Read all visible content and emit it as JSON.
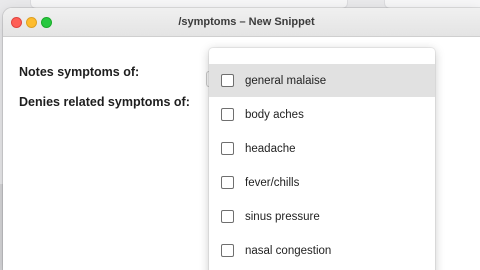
{
  "window": {
    "title": "/symptoms – New Snippet"
  },
  "form": {
    "notes_label": "Notes symptoms of:",
    "denies_label": "Denies related symptoms of:"
  },
  "dropdown": {
    "options": [
      {
        "label": "general malaise",
        "checked": false,
        "highlighted": true
      },
      {
        "label": "body aches",
        "checked": false,
        "highlighted": false
      },
      {
        "label": "headache",
        "checked": false,
        "highlighted": false
      },
      {
        "label": "fever/chills",
        "checked": false,
        "highlighted": false
      },
      {
        "label": "sinus pressure",
        "checked": false,
        "highlighted": false
      },
      {
        "label": "nasal congestion",
        "checked": false,
        "highlighted": false
      }
    ]
  }
}
